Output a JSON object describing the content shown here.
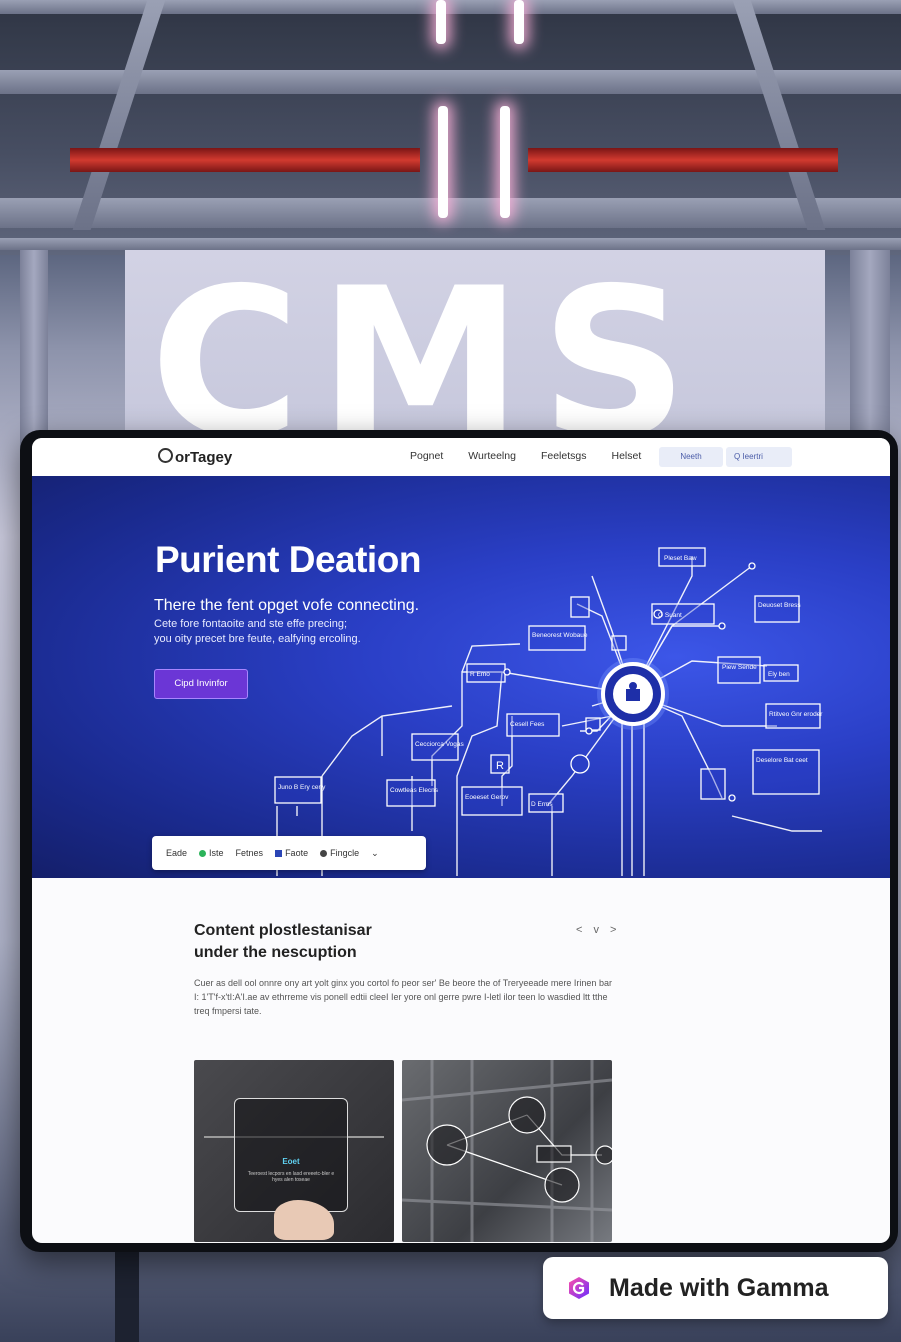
{
  "backdrop": {
    "sign_text": "CMS"
  },
  "site": {
    "logo": "orTagey",
    "nav": [
      "Pognet",
      "Wurteelng",
      "Feeletsgs",
      "Helset"
    ],
    "nav_button": "Neeth",
    "nav_search": "Q  Ieertri"
  },
  "hero": {
    "title": "Purient Deation",
    "subtitle": "There the fent opget vofe connecting.",
    "line2": "Cete fore fontaoite and ste effe precing;",
    "line3": "you oity precet bre feute, ealfying ercoling.",
    "cta": "Cipd Invinfor",
    "bar": {
      "item1": "Eade",
      "item2": "Iste",
      "item3": "Fetnes",
      "item4": "Faote",
      "item5": "Fingcle",
      "chevron": "⌄"
    },
    "diagram_labels": {
      "top": "Pleset Baw",
      "top_right": "Deuoset Bress",
      "node_a": "O Suant",
      "node_b": "Beneorest Wobaue",
      "node_c": "R Emo",
      "node_d": "Piew Sende",
      "node_e": "Ely ben",
      "node_f": "Cesell Fees",
      "node_g": "Rtitveo Gnr eroder",
      "node_h": "Cecciorca Vogas",
      "node_i": "Cowtleas Elecns",
      "node_j": "Deselore Bat ceet",
      "node_k": "Eoeeset Gerov",
      "node_l": "D Erms",
      "node_m": "Juno B Ery ceny",
      "icon_text": "R",
      "hub": "hub"
    }
  },
  "content": {
    "title_line1": "Content plostlestanisar",
    "title_line2": "under the nescuption",
    "controls": "< v >",
    "body": "Cuer as dell ool onnre ony art yolt ginx you cortol fo peor ser' Be beore the of Treryeeade mere Irinen bar I: 1'T'f-x'tI:A'I.ae av ethrreme vis ponell edtii cleeI Ier yore onl gerre pwre I-letl ilor teen lo wasdied ltt tthe treq fmpersi tate.",
    "card1_label": "Eoet",
    "card1_text": "Teeroest lecpors en lasd ereeetc-bler e hyes alen toseae"
  },
  "badge": {
    "text": "Made with Gamma"
  },
  "colors": {
    "hero_start": "#141f6a",
    "hero_glow": "#3c56e8",
    "cta": "#6b36d6",
    "badge_icon_start": "#ff4fa8",
    "badge_icon_end": "#6a2cff"
  }
}
